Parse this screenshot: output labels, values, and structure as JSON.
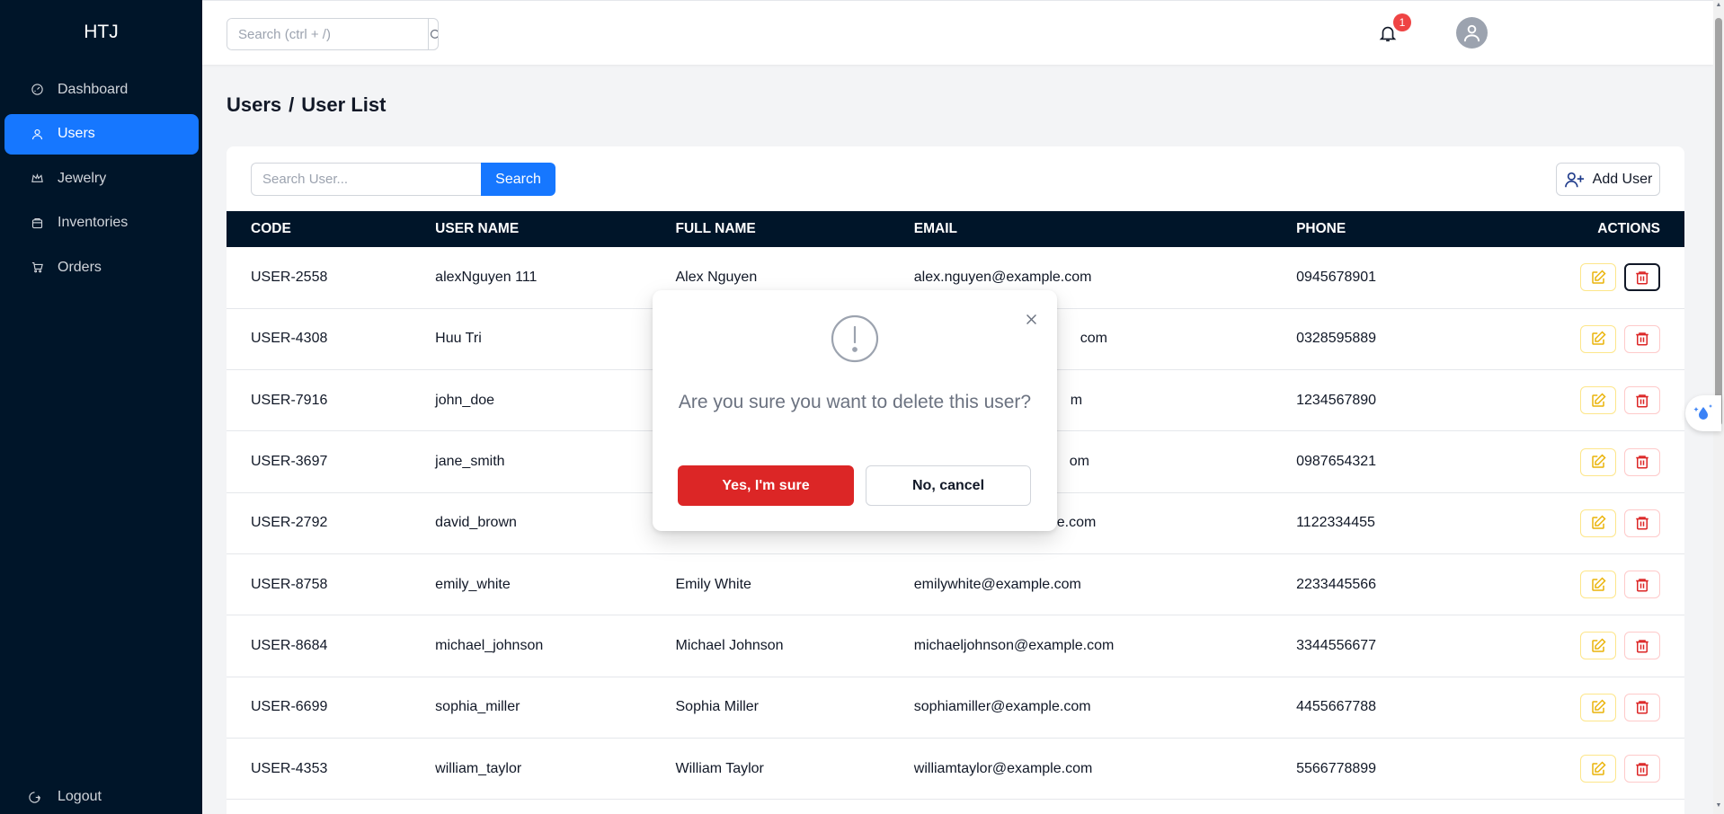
{
  "app": {
    "brand": "HTJ"
  },
  "sidebar": {
    "items": [
      {
        "label": "Dashboard",
        "icon": "dashboard-icon",
        "active": false
      },
      {
        "label": "Users",
        "icon": "user-icon",
        "active": true
      },
      {
        "label": "Jewelry",
        "icon": "jewelry-icon",
        "active": false
      },
      {
        "label": "Inventories",
        "icon": "inventory-icon",
        "active": false
      },
      {
        "label": "Orders",
        "icon": "cart-icon",
        "active": false
      }
    ],
    "logout_label": "Logout"
  },
  "header": {
    "search_placeholder": "Search (ctrl + /)",
    "notification_count": "1"
  },
  "page": {
    "breadcrumb_root": "Users",
    "breadcrumb_sep": "/",
    "breadcrumb_current": "User List"
  },
  "toolbar": {
    "search_placeholder": "Search User...",
    "search_label": "Search",
    "add_label": "Add User"
  },
  "table": {
    "headers": [
      "CODE",
      "USER NAME",
      "FULL NAME",
      "EMAIL",
      "PHONE",
      "ACTIONS"
    ],
    "rows": [
      {
        "code": "USER-2558",
        "username": "alexNguyen 111",
        "fullname": "Alex Nguyen",
        "email": "alex.nguyen@example.com",
        "phone": "0945678901"
      },
      {
        "code": "USER-4308",
        "username": "Huu Tri",
        "fullname": "",
        "email": "com",
        "phone": "0328595889"
      },
      {
        "code": "USER-7916",
        "username": "john_doe",
        "fullname": "",
        "email": "m",
        "phone": "1234567890"
      },
      {
        "code": "USER-3697",
        "username": "jane_smith",
        "fullname": "",
        "email": "om",
        "phone": "0987654321"
      },
      {
        "code": "USER-2792",
        "username": "david_brown",
        "fullname": "",
        "email": "e.com",
        "phone": "1122334455"
      },
      {
        "code": "USER-8758",
        "username": "emily_white",
        "fullname": "Emily White",
        "email": "emilywhite@example.com",
        "phone": "2233445566"
      },
      {
        "code": "USER-8684",
        "username": "michael_johnson",
        "fullname": "Michael Johnson",
        "email": "michaeljohnson@example.com",
        "phone": "3344556677"
      },
      {
        "code": "USER-6699",
        "username": "sophia_miller",
        "fullname": "Sophia Miller",
        "email": "sophiamiller@example.com",
        "phone": "4455667788"
      },
      {
        "code": "USER-4353",
        "username": "william_taylor",
        "fullname": "William Taylor",
        "email": "williamtaylor@example.com",
        "phone": "5566778899"
      }
    ]
  },
  "modal": {
    "message": "Are you sure you want to delete this user?",
    "confirm_label": "Yes, I'm sure",
    "cancel_label": "No, cancel"
  },
  "colors": {
    "sidebar_bg": "#001529",
    "accent": "#1677ff",
    "danger": "#dc2626",
    "edit": "#eab308"
  }
}
